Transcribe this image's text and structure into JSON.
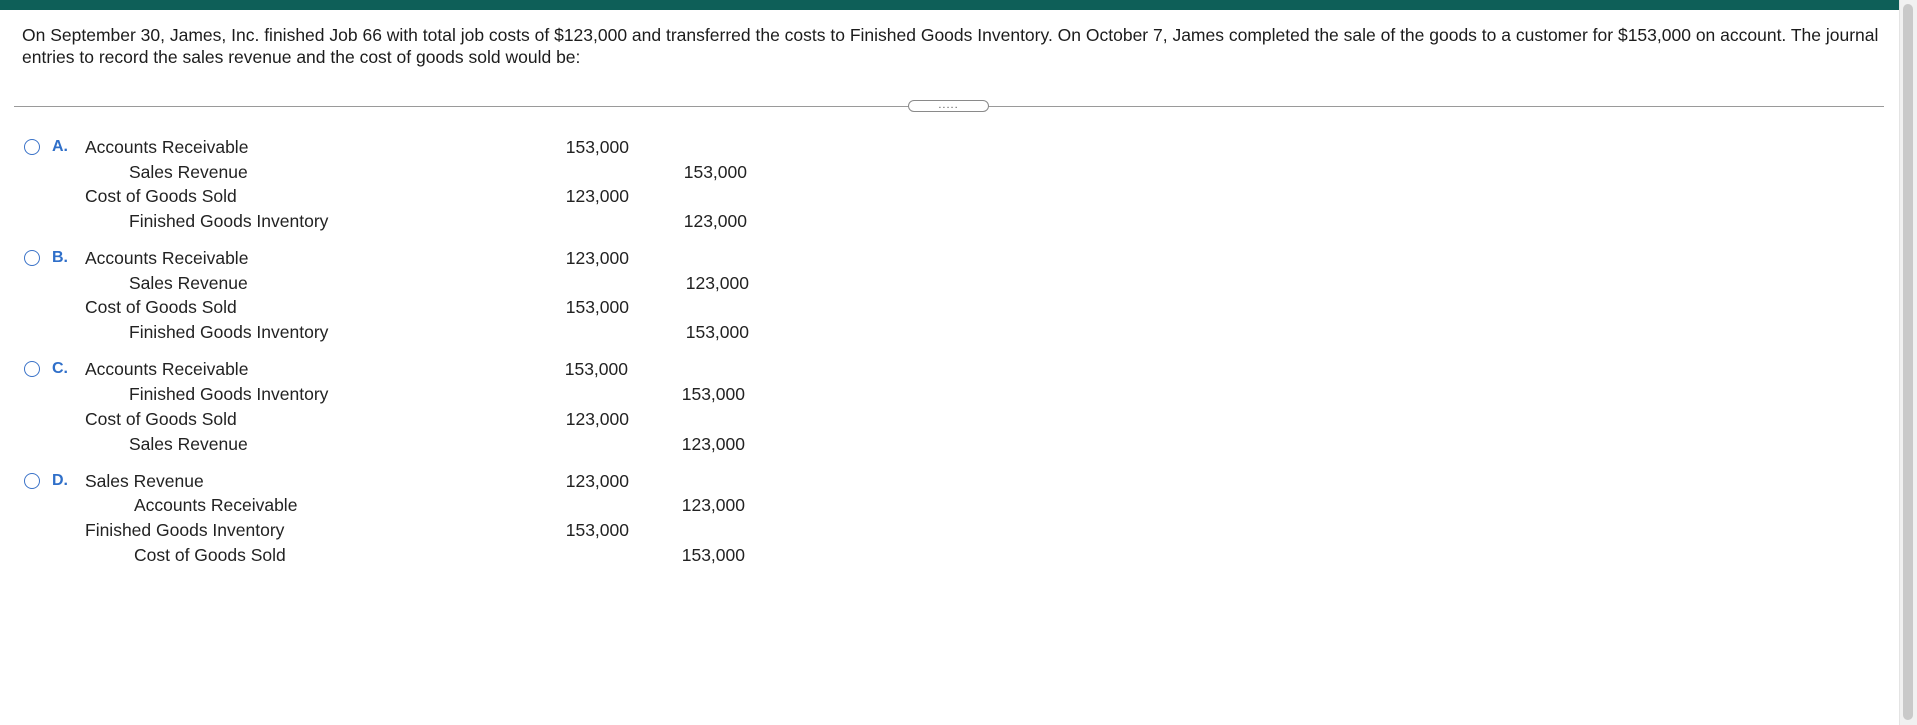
{
  "question": {
    "text": "On September 30, James, Inc. finished Job 66 with total job costs of $123,000 and transferred the costs to Finished Goods Inventory. On October 7, James completed the sale of the goods to a customer for $153,000 on account. The journal entries to record the sales revenue and the cost of goods sold would be:"
  },
  "splitter": {
    "label": "....."
  },
  "options": [
    {
      "letter": "A.",
      "rows": [
        {
          "account": "Accounts Receivable",
          "debit": "153,000",
          "credit": ""
        },
        {
          "account": "Sales Revenue",
          "debit": "",
          "credit": "153,000"
        },
        {
          "account": "Cost of Goods Sold",
          "debit": "123,000",
          "credit": ""
        },
        {
          "account": "Finished Goods Inventory",
          "debit": "",
          "credit": "123,000"
        }
      ]
    },
    {
      "letter": "B.",
      "rows": [
        {
          "account": "Accounts Receivable",
          "debit": "123,000",
          "credit": ""
        },
        {
          "account": "Sales Revenue",
          "debit": "",
          "credit": "123,000"
        },
        {
          "account": "Cost of Goods Sold",
          "debit": "153,000",
          "credit": ""
        },
        {
          "account": "Finished Goods Inventory",
          "debit": "",
          "credit": "153,000"
        }
      ]
    },
    {
      "letter": "C.",
      "rows": [
        {
          "account": "Accounts Receivable",
          "debit": "153,000",
          "credit": ""
        },
        {
          "account": "Finished Goods Inventory",
          "debit": "",
          "credit": "153,000"
        },
        {
          "account": "Cost of Goods Sold",
          "debit": "123,000",
          "credit": ""
        },
        {
          "account": "Sales Revenue",
          "debit": "",
          "credit": "123,000"
        }
      ]
    },
    {
      "letter": "D.",
      "rows": [
        {
          "account": "Sales Revenue",
          "debit": "123,000",
          "credit": ""
        },
        {
          "account": "Accounts Receivable",
          "debit": "",
          "credit": "123,000"
        },
        {
          "account": "Finished Goods Inventory",
          "debit": "153,000",
          "credit": ""
        },
        {
          "account": "Cost of Goods Sold",
          "debit": "",
          "credit": "153,000"
        }
      ]
    }
  ],
  "colors": {
    "topbar": "#0e5f58",
    "option_letter": "#2f6fc9",
    "radio_border": "#3b73c8"
  }
}
